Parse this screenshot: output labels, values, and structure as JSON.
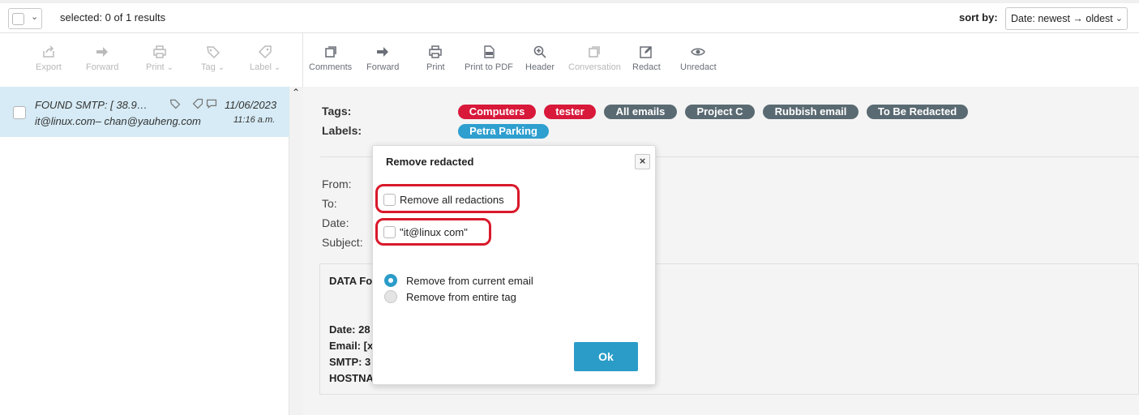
{
  "header": {
    "selected_text": "selected: 0 of 1 results",
    "sort_label": "sort by:",
    "sort_value": "Date: newest → oldest"
  },
  "left_toolbar": [
    {
      "label": "Export",
      "icon": "export-icon"
    },
    {
      "label": "Forward",
      "icon": "forward-arrow-icon"
    },
    {
      "label": "Print",
      "icon": "printer-icon",
      "dropdown": true
    },
    {
      "label": "Tag",
      "icon": "tag-icon",
      "dropdown": true
    },
    {
      "label": "Label",
      "icon": "label-icon",
      "dropdown": true
    }
  ],
  "right_toolbar": [
    {
      "label": "Comments",
      "icon": "comments-icon"
    },
    {
      "label": "Forward",
      "icon": "forward-arrow-icon"
    },
    {
      "label": "Print",
      "icon": "printer-icon"
    },
    {
      "label": "Print to PDF",
      "icon": "pdf-icon"
    },
    {
      "label": "Header",
      "icon": "zoom-in-icon"
    },
    {
      "label": "Conversation",
      "icon": "conversation-icon"
    },
    {
      "label": "Redact",
      "icon": "edit-icon"
    },
    {
      "label": "Unredact",
      "icon": "eye-icon"
    }
  ],
  "message": {
    "subject": "FOUND SMTP: [ 38.9…",
    "from": "it@linux.com–  chan@yauheng.com",
    "date": "11/06/2023",
    "time": "11:16 a.m."
  },
  "meta": {
    "tags_label": "Tags:",
    "labels_label": "Labels:",
    "tags": [
      {
        "text": "Computers",
        "color": "#d8193a"
      },
      {
        "text": "tester",
        "color": "#d8193a"
      },
      {
        "text": "All emails",
        "color": "#5a6a72"
      },
      {
        "text": "Project C",
        "color": "#5a6a72"
      },
      {
        "text": "Rubbish email",
        "color": "#5a6a72"
      },
      {
        "text": "To Be Redacted",
        "color": "#5a6a72"
      }
    ],
    "labels": [
      {
        "text": "Petra Parking",
        "color": "#2e9fcf"
      }
    ]
  },
  "headers": {
    "from_label": "From:",
    "to_label": "To:",
    "date_label": "Date:",
    "subject_label": "Subject:"
  },
  "body": {
    "line1": "DATA Fo",
    "line2": "Date: 28",
    "line3": "Email: [x",
    "line4": "SMTP: 3",
    "line5": "HOSTNA"
  },
  "modal": {
    "title": "Remove redacted",
    "close": "×",
    "option_all": "Remove all redactions",
    "option_item": "\"it@linux com\"",
    "radio_current": "Remove from current email",
    "radio_tag": "Remove from entire tag",
    "ok": "Ok"
  }
}
